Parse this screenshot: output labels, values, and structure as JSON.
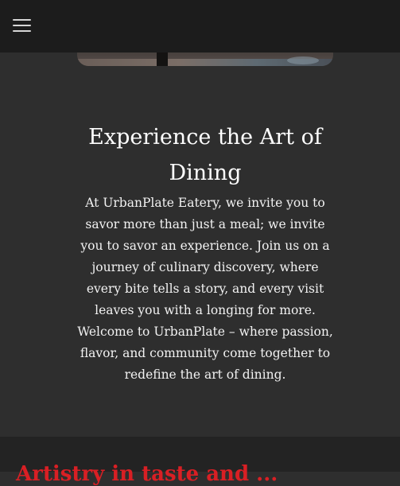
{
  "nav": {
    "menu_icon": "hamburger-menu-icon"
  },
  "hero": {
    "image": "restaurant-interior-photo"
  },
  "intro": {
    "title": "Experience the Art of Dining",
    "body": "At UrbanPlate Eatery, we invite you to savor more than just a meal; we invite you to savor an experience. Join us on a journey of culinary discovery, where every bite tells a story, and every visit leaves you with a longing for more. Welcome to UrbanPlate – where passion, flavor, and community come together to redefine the art of dining."
  },
  "next_section": {
    "heading": "Artistry in taste and ..."
  },
  "colors": {
    "header_bg": "#1c1c1c",
    "page_bg": "#2e2e2e",
    "section_bg": "#232323",
    "accent": "#d91f24",
    "text": "#ffffff"
  }
}
